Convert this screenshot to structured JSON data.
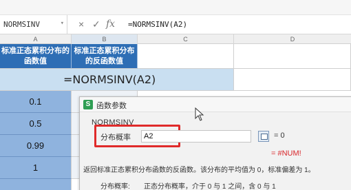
{
  "formula_bar": {
    "name_box": "NORMSINV",
    "name_box_arrow": "▾",
    "cancel_glyph": "×",
    "enter_glyph": "✓",
    "fx_glyph": "fx",
    "formula": "=NORMSINV(A2)"
  },
  "columns": [
    "A",
    "B",
    "C",
    "D"
  ],
  "sheet": {
    "header_a": "标准正态累积分布的函数值",
    "header_b": "标准正态累积分布的反函数值",
    "merged_formula": "=NORMSINV(A2)",
    "values": [
      "0.1",
      "0.5",
      "0.99",
      "1"
    ]
  },
  "dialog": {
    "icon_letter": "S",
    "title": "函数参数",
    "function_name": "NORMSINV",
    "arg_label": "分布概率",
    "arg_value": "A2",
    "arg_result": "= 0",
    "result": "= #NUM!",
    "description": "返回标准正态累积分布函数的反函数。该分布的平均值为 0，标准偏差为 1。",
    "arg_desc_label": "分布概率:",
    "arg_desc_text": "正态分布概率，介于 0 与 1 之间，含 0 与 1"
  },
  "colors": {
    "header_blue": "#2e6eb5",
    "value_blue": "#8fb3de",
    "merged_light": "#c9dff1",
    "highlight_red": "#e02a2a",
    "error_red": "#d8262a",
    "dialog_icon_green": "#2f9e54"
  },
  "icons": [
    "cancel-icon",
    "enter-icon",
    "fx-icon",
    "dialog-app-icon",
    "range-select-icon",
    "mouse-cursor-icon"
  ]
}
